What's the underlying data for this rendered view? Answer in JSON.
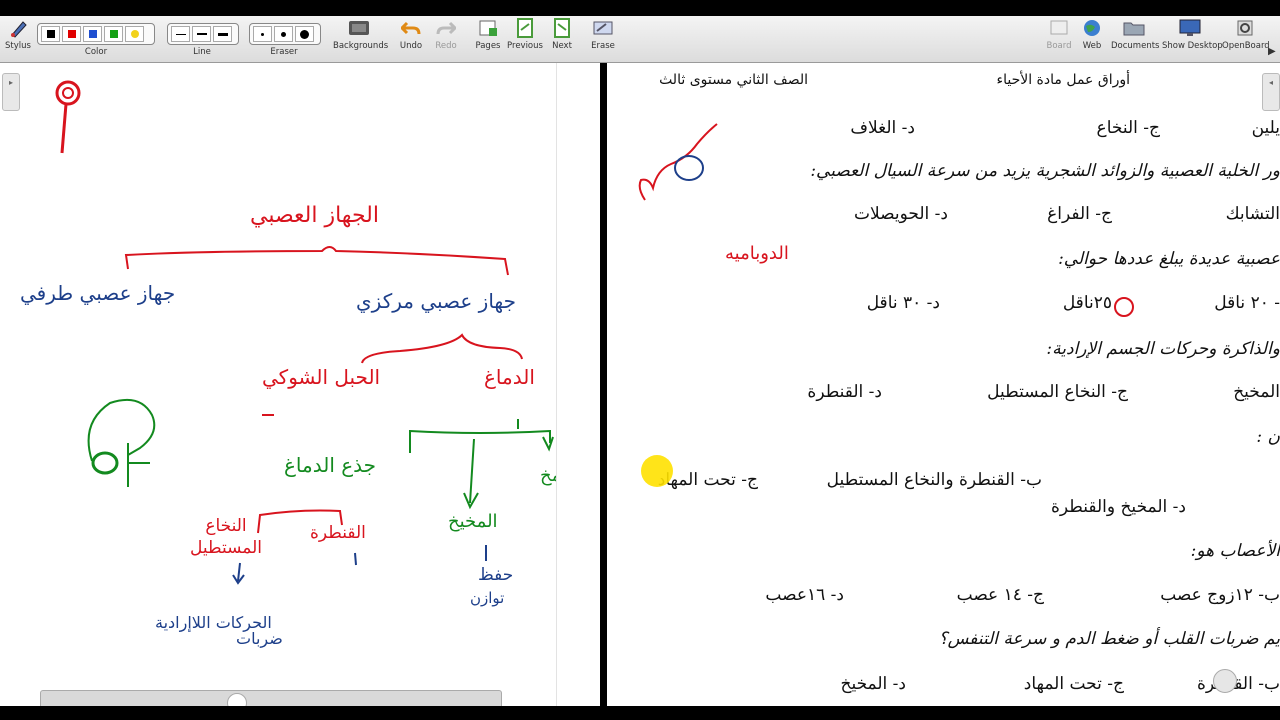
{
  "toolbar": {
    "stylus": "Stylus",
    "color": "Color",
    "line": "Line",
    "eraser": "Eraser",
    "backgrounds": "Backgrounds",
    "undo": "Undo",
    "redo": "Redo",
    "pages": "Pages",
    "previous": "Previous",
    "next": "Next",
    "erase": "Erase",
    "board": "Board",
    "web": "Web",
    "documents": "Documents",
    "show_desktop": "Show Desktop",
    "openboard": "OpenBoard",
    "colors": [
      "#000000",
      "#e00000",
      "#1f4fd0",
      "#14a014",
      "#f2d21b"
    ]
  },
  "board": {
    "title": "الجهاز العصبي",
    "peripheral": "جهاز عصبي طرفي",
    "central": "جهاز عصبي مركزي",
    "spinal_cord": "الحبل الشوكي",
    "brain": "الدماغ",
    "brainstem": "جذع الدماغ",
    "cerebellum": "المخيخ",
    "cerebrum": "المخ",
    "medulla": "النخاع المستطيل",
    "pons": "القنطرة",
    "cerebellum_role_1": "حفظ",
    "cerebellum_role_2": "توازن",
    "medulla_role_1": "الحركات اللاإرادية",
    "medulla_role_2": "ضربات",
    "accents": {
      "red": "#d8141e",
      "green": "#138a1f",
      "blue": "#1d3f8a"
    }
  },
  "doc": {
    "header_right": "أوراق عمل مادة الأحياء",
    "header_left": "الصف الثاني مستوى ثالث",
    "row1": {
      "a": "يلين",
      "c": "ج- النخاع",
      "d": "د- الغلاف"
    },
    "q2": "ور الخلية العصبية والزوائد الشجرية يزيد من سرعة السيال العصبي:",
    "row2": {
      "a": "التشابك",
      "c": "ج- الفراغ",
      "d": "د- الحويصلات"
    },
    "q3": "عصبية عديدة يبلغ عددها حوالي:",
    "annot_red": "الدوباميه",
    "row3": {
      "a": "- ٢٠ ناقل",
      "c": "٢٥ناقل",
      "d": "د- ٣٠ ناقل"
    },
    "q4": "والذاكرة وحركات الجسم الإرادية:",
    "row4": {
      "a": "المخيخ",
      "c": "ج- النخاع المستطيل",
      "d": "د- القنطرة"
    },
    "q5": "ن :",
    "row5": {
      "b": "ب- القنطرة والنخاع المستطيل",
      "c": "ج- تحت المهاد"
    },
    "row5b": "د- المخيخ والقنطرة",
    "q6": "الأعصاب هو:",
    "row6": {
      "b": "ب- ١٢زوج عصب",
      "c": "ج- ١٤ عصب",
      "d": "د- ١٦عصب"
    },
    "q7": "يم ضربات القلب أو ضغط الدم و سرعة التنفس؟",
    "row7": {
      "b": "ب- القنطرة",
      "c": "ج- تحت المهاد",
      "d": "د- المخيخ"
    }
  }
}
